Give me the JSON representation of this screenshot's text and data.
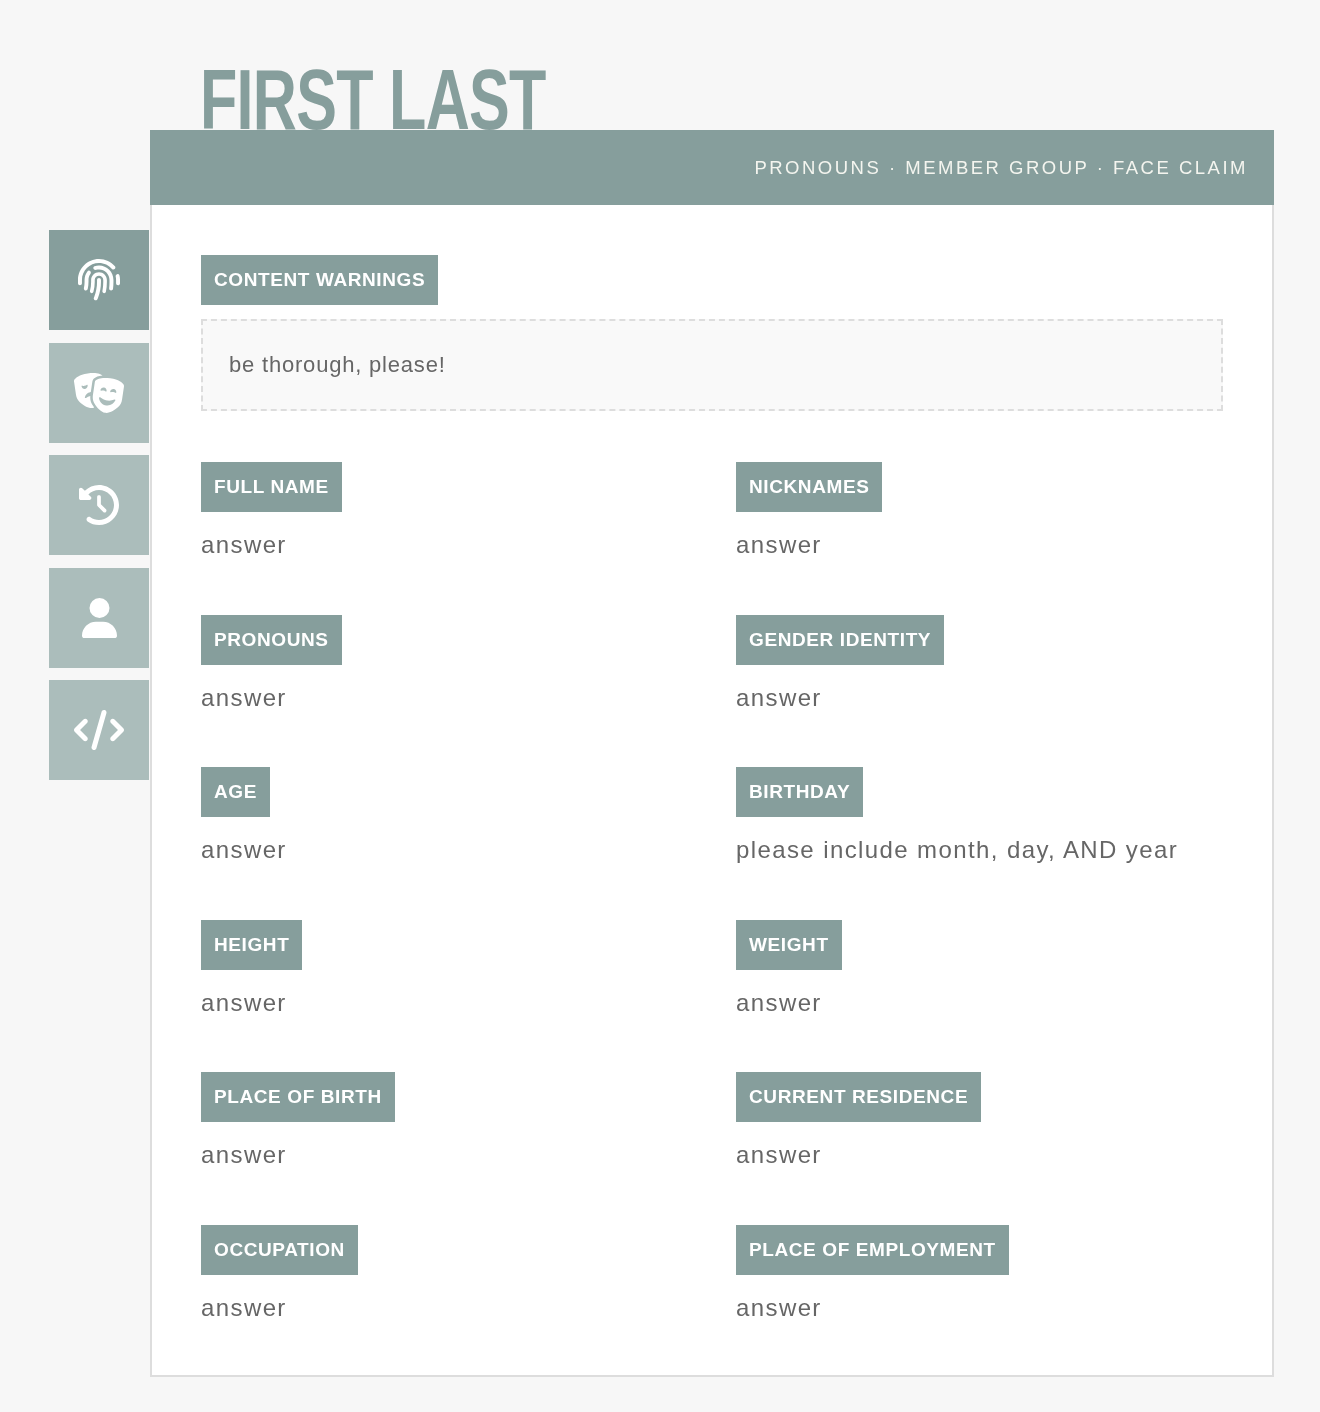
{
  "profile": {
    "name": "FIRST LAST",
    "meta": "PRONOUNS · MEMBER GROUP · FACE CLAIM"
  },
  "tabs": [
    {
      "kind": "fingerprint",
      "selected": true
    },
    {
      "kind": "masks",
      "selected": false
    },
    {
      "kind": "history",
      "selected": false
    },
    {
      "kind": "user",
      "selected": false
    },
    {
      "kind": "code",
      "selected": false
    }
  ],
  "content_warnings": {
    "label": "CONTENT WARNINGS",
    "text": "be thorough, please!"
  },
  "fields": [
    {
      "label": "FULL NAME",
      "answer": "answer"
    },
    {
      "label": "NICKNAMES",
      "answer": "answer"
    },
    {
      "label": "PRONOUNS",
      "answer": "answer"
    },
    {
      "label": "GENDER IDENTITY",
      "answer": "answer"
    },
    {
      "label": "AGE",
      "answer": "answer"
    },
    {
      "label": "BIRTHDAY",
      "answer": "please include month, day, AND year"
    },
    {
      "label": "HEIGHT",
      "answer": "answer"
    },
    {
      "label": "WEIGHT",
      "answer": "answer"
    },
    {
      "label": "PLACE OF BIRTH",
      "answer": "answer"
    },
    {
      "label": "CURRENT RESIDENCE",
      "answer": "answer"
    },
    {
      "label": "OCCUPATION",
      "answer": "answer"
    },
    {
      "label": "PLACE OF EMPLOYMENT",
      "answer": "answer"
    }
  ]
}
